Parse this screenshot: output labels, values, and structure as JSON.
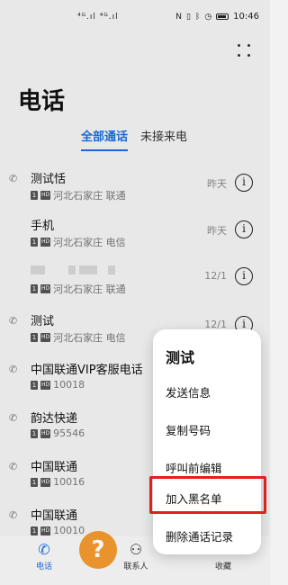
{
  "status_bar": {
    "signal_text": "⁴ᴳ.ıl ⁴ᴳ.ıl",
    "nfc": "N",
    "time": "10:46"
  },
  "header": {
    "title": "电话",
    "tabs": [
      "全部通话",
      "未接来电"
    ]
  },
  "calls": [
    {
      "name": "测试恬",
      "location": "河北石家庄 联通",
      "date": "昨天"
    },
    {
      "name": "手机",
      "location": "河北石家庄 电信",
      "date": "昨天"
    },
    {
      "name": "",
      "location": "河北石家庄 联通",
      "date": "12/1"
    },
    {
      "name": "测试",
      "location": "河北石家庄 电信",
      "date": "12/1"
    },
    {
      "name": "中国联通VIP客服电话",
      "location": "10018",
      "date": ""
    },
    {
      "name": "韵达快递",
      "location": "95546",
      "date": ""
    },
    {
      "name": "中国联通",
      "location": "10016",
      "date": ""
    },
    {
      "name": "中国联通",
      "location": "10010",
      "date": ""
    }
  ],
  "popup": {
    "title": "测试",
    "items": [
      "发送信息",
      "复制号码",
      "呼叫前编辑",
      "加入黑名单",
      "删除通话记录"
    ]
  },
  "bottom_nav": {
    "phone": "电话",
    "contacts": "联系人",
    "favorites": "收藏"
  },
  "help_badge": "?",
  "icons": {
    "call_icon": "phone-outgoing-icon",
    "info_icon": "info-icon",
    "sim_icon": "sim1-icon"
  },
  "colors": {
    "accent": "#1a6de0",
    "highlight": "#e02020",
    "help": "#f29a2e"
  }
}
